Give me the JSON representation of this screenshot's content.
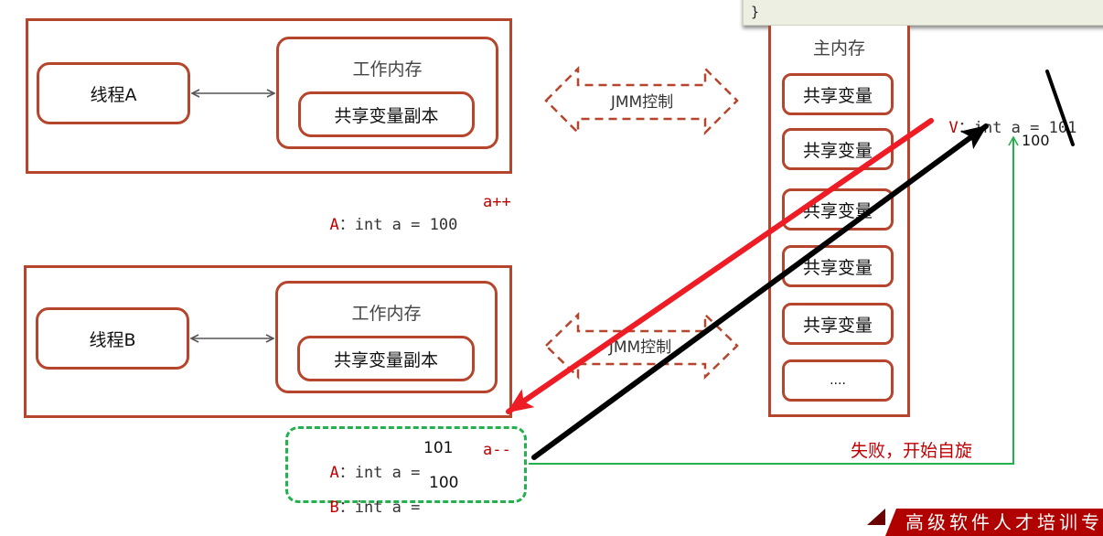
{
  "code_panel": {
    "text": "}"
  },
  "thread_a": {
    "thread_label": "线程A",
    "working_memory_title": "工作内存",
    "copy_label": "共享变量副本"
  },
  "thread_b": {
    "thread_label": "线程B",
    "working_memory_title": "工作内存",
    "copy_label": "共享变量副本"
  },
  "jmm": {
    "top_label": "JMM控制",
    "bottom_label": "JMM控制"
  },
  "main_memory": {
    "title": "主内存",
    "items": [
      "共享变量",
      "共享变量",
      "共享变量",
      "共享变量",
      "共享变量",
      "...."
    ]
  },
  "annotations": {
    "a_line": {
      "prefix": "A",
      "sep": "：",
      "code": "int a = 100",
      "op": "a++"
    },
    "v_line": {
      "prefix": "V",
      "sep": "：",
      "code": "int a = 101"
    },
    "v_old": "100",
    "box_a": {
      "prefix": "A",
      "sep": "：",
      "code": "int a = ",
      "value": "101",
      "op": "a--"
    },
    "box_b": {
      "prefix": "B",
      "sep": "：",
      "code": "int a = ",
      "value": "100"
    },
    "fail_text": "失败，开始自旋"
  },
  "footer_banner": "高级软件人才培训专家",
  "colors": {
    "box_border": "#b5452c",
    "red_arrow": "#ee1c25",
    "black_arrow": "#000000",
    "green_line": "#22b14c",
    "label_red": "#c00000",
    "banner": "#b00000"
  }
}
